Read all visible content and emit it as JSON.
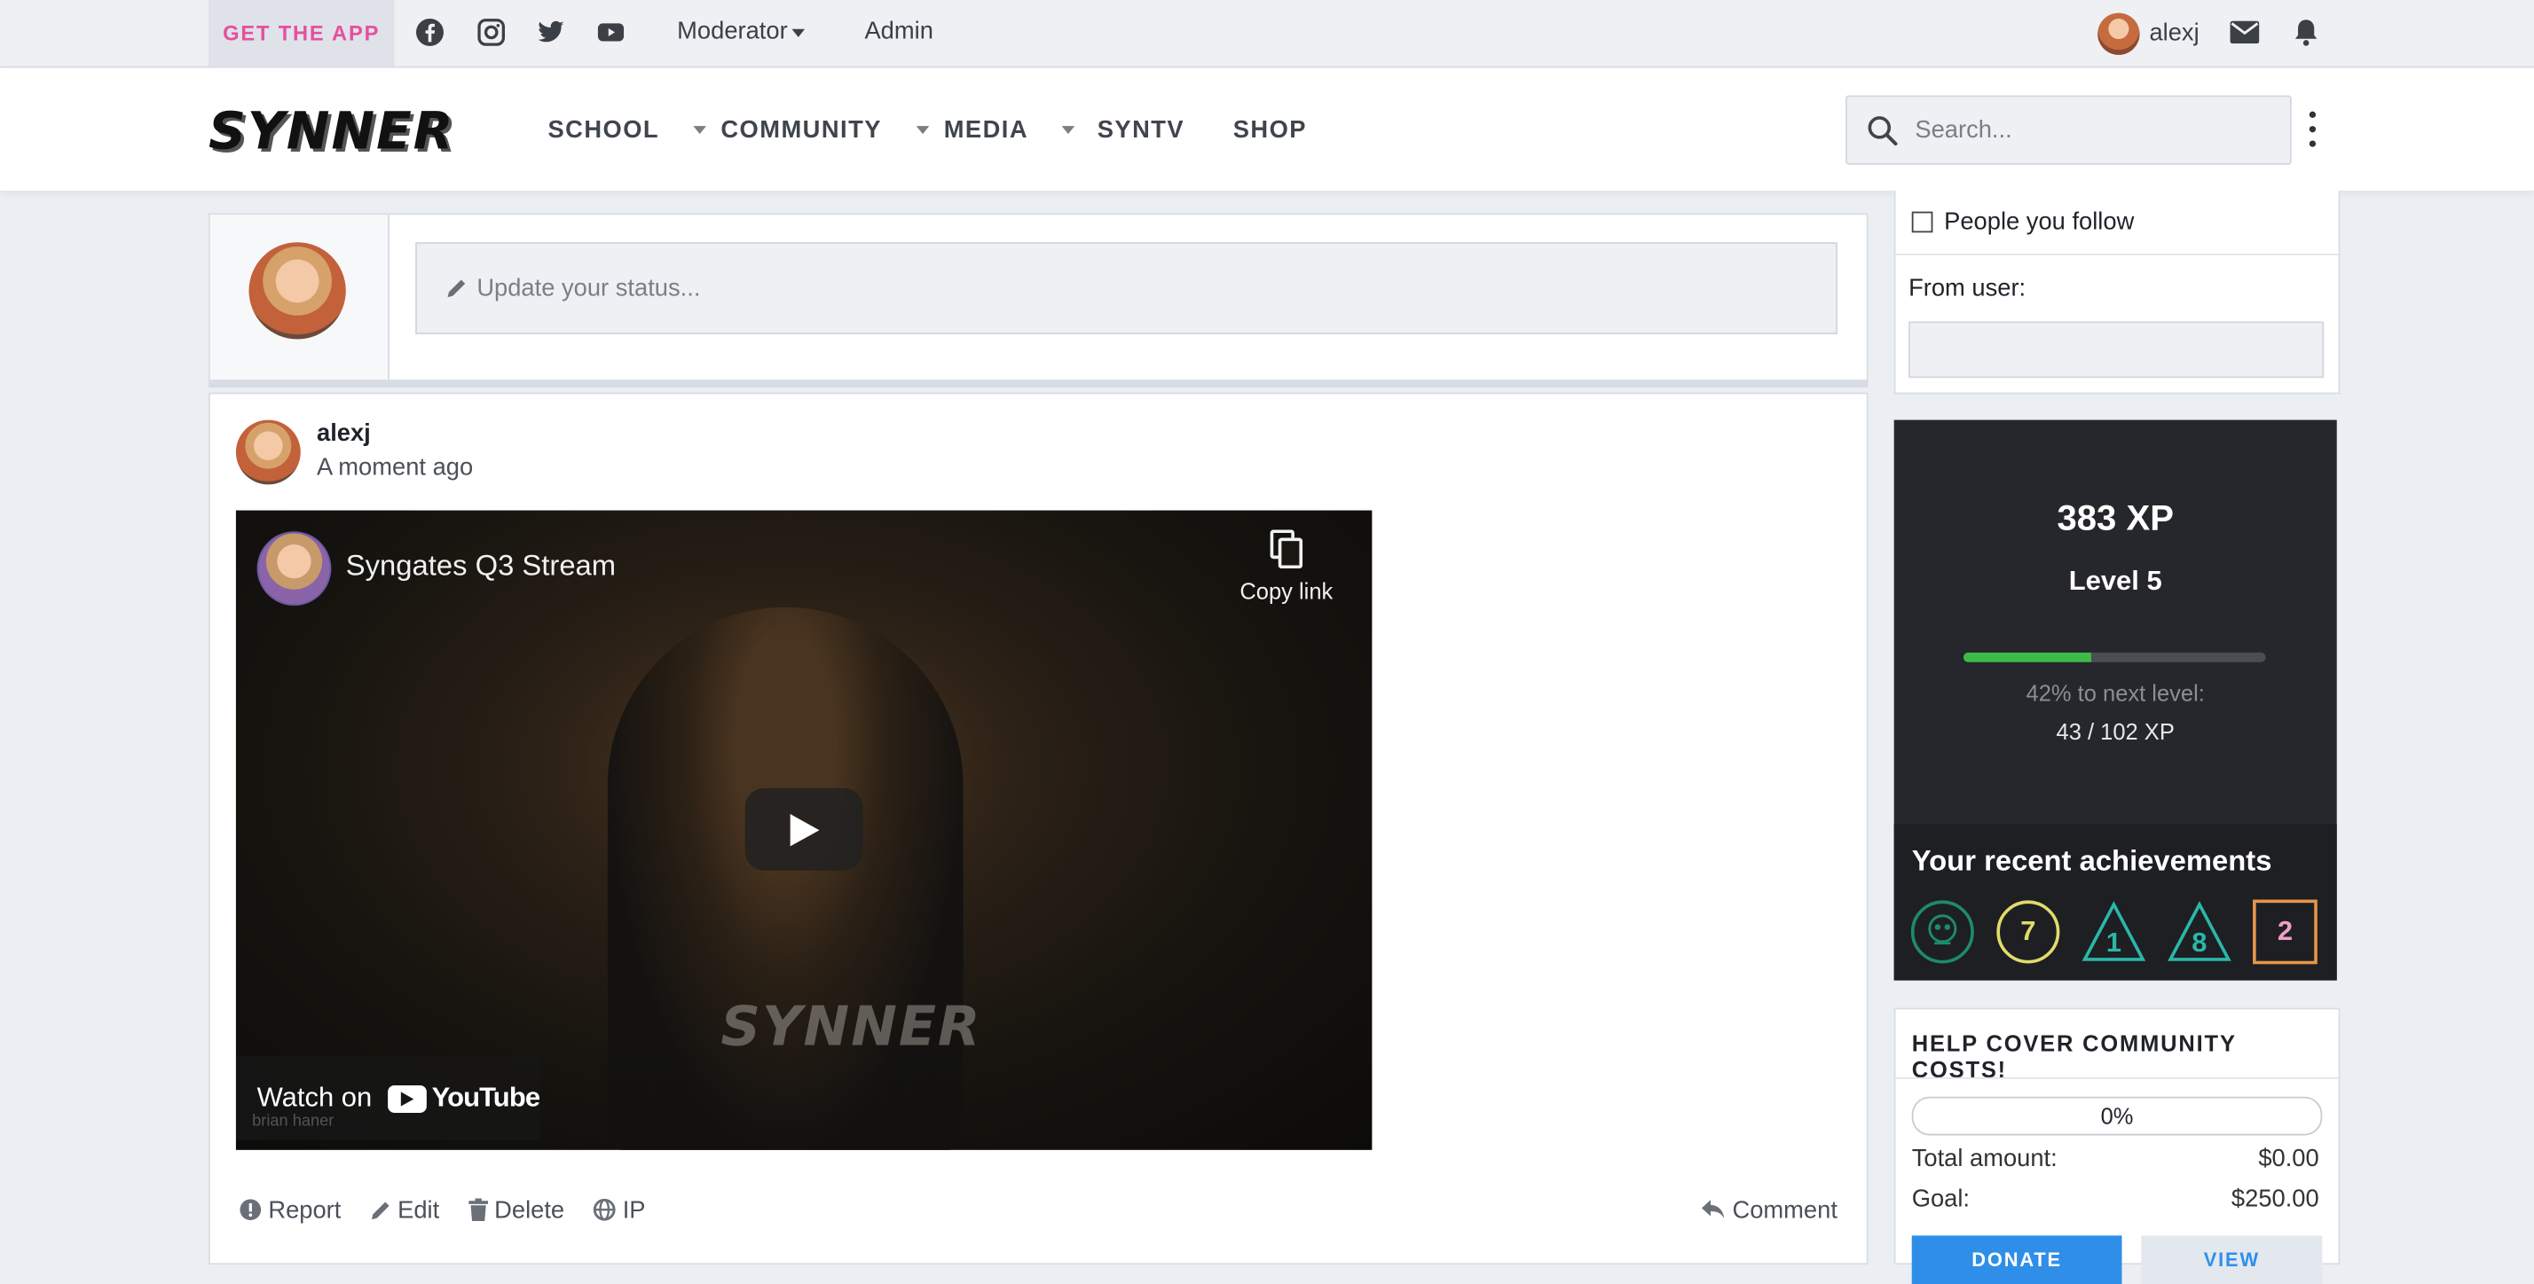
{
  "topbar": {
    "get_app": "GET THE APP",
    "moderator": "Moderator",
    "admin": "Admin",
    "username": "alexj"
  },
  "header": {
    "logo": "SYNNER",
    "nav": [
      "SCHOOL",
      "COMMUNITY",
      "MEDIA",
      "SYNTV",
      "SHOP"
    ],
    "search_placeholder": "Search..."
  },
  "composer": {
    "placeholder": "Update your status..."
  },
  "post": {
    "author": "alexj",
    "time": "A moment ago",
    "video": {
      "title": "Syngates Q3 Stream",
      "copy_link": "Copy link",
      "watch_on": "Watch on",
      "youtube": "YouTube",
      "shirt_text": "SYNNER",
      "watermark": "brian haner"
    },
    "actions": {
      "report": "Report",
      "edit": "Edit",
      "delete": "Delete",
      "ip": "IP",
      "comment": "Comment"
    }
  },
  "sidebar": {
    "filter": {
      "people_you_follow": "People you follow",
      "from_user": "From user:"
    },
    "xp": {
      "xp_value": "383 XP",
      "level": "Level 5",
      "progress_fraction": 0.42,
      "next_level_text": "42% to next level:",
      "progress_text": "43 / 102 XP",
      "achievements_title": "Your recent achievements",
      "badges": [
        "",
        "7",
        "1",
        "8",
        "2"
      ]
    },
    "donate": {
      "title": "HELP COVER COMMUNITY COSTS!",
      "percent": "0%",
      "total_label": "Total amount:",
      "total_value": "$0.00",
      "goal_label": "Goal:",
      "goal_value": "$250.00",
      "donate_button": "DONATE",
      "view_button": "VIEW"
    }
  },
  "colors": {
    "accent_pink": "#e64fa0",
    "xp_green": "#3dbb48",
    "donate_blue": "#2f8fe8"
  }
}
